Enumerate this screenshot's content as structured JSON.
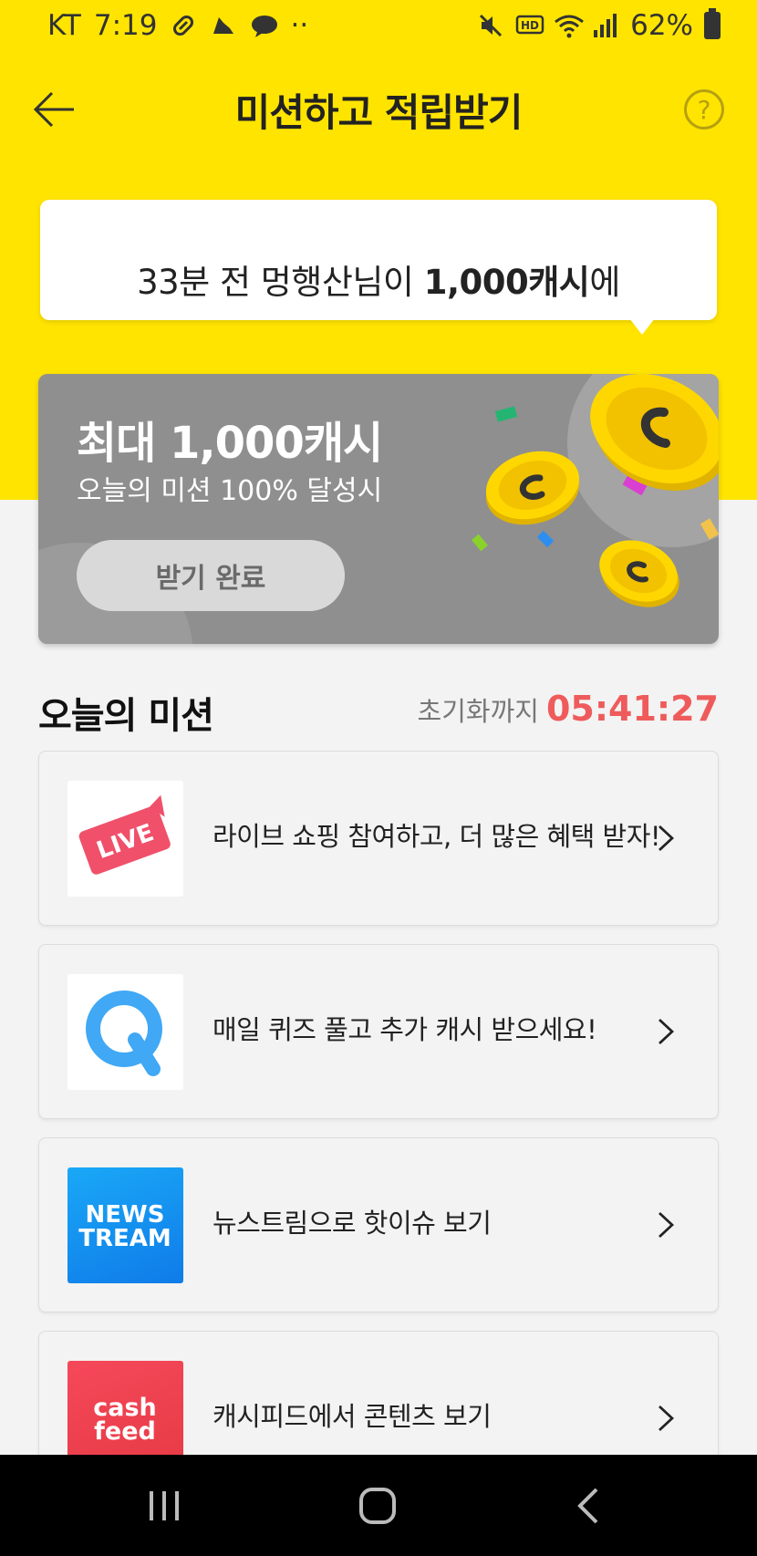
{
  "status_bar": {
    "carrier": "KT",
    "time": "7:19",
    "dots": "··",
    "battery_percent": "62%"
  },
  "header": {
    "title": "미션하고 적립받기",
    "help_symbol": "?"
  },
  "notice": {
    "prefix": "33분 전 멍행산님이 ",
    "amount": "1,000캐시",
    "suffix": "에"
  },
  "banner": {
    "title": "최대 1,000캐시",
    "subtitle": "오늘의 미션 100% 달성시",
    "button_label": "받기 완료"
  },
  "missions_section": {
    "title": "오늘의 미션",
    "reset_label": "초기화까지",
    "reset_time": "05:41:27"
  },
  "missions": [
    {
      "label": "라이브 쇼핑 참여하고, 더 많은 혜택 받자!",
      "thumb_text": "LIVE"
    },
    {
      "label": "매일 퀴즈 풀고 추가 캐시 받으세요!",
      "thumb_text": "Q"
    },
    {
      "label": "뉴스트림으로 핫이슈 보기",
      "thumb_text_1": "NEWS",
      "thumb_text_2": "TREAM"
    },
    {
      "label": "캐시피드에서 콘텐츠 보기",
      "thumb_text_1": "cash",
      "thumb_text_2": "feed"
    }
  ],
  "colors": {
    "brand_yellow": "#ffe400",
    "timer_red": "#ef5b5b",
    "banner_gray": "#8f8f8f"
  }
}
